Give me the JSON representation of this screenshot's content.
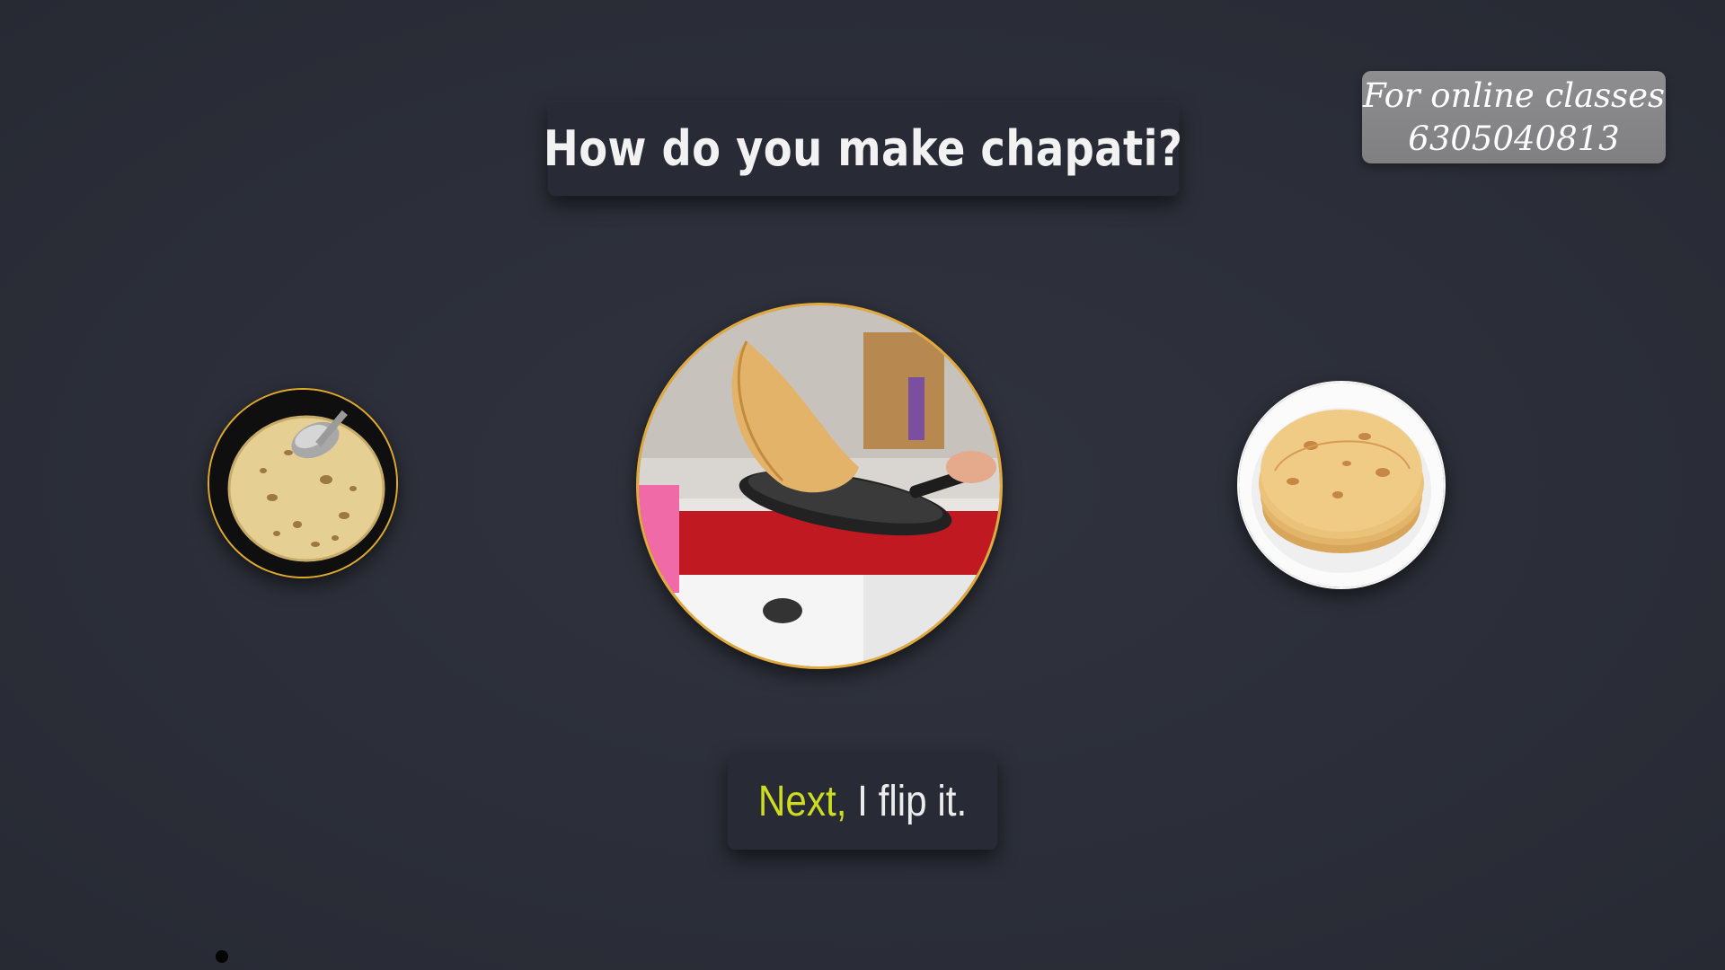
{
  "title": "How do you make chapati?",
  "promo": {
    "line1": "For online classes",
    "line2": "6305040813"
  },
  "caption": {
    "highlight": "Next,",
    "rest": " I flip it."
  },
  "images": [
    {
      "name": "chapati-on-pan",
      "icon": "chapati-with-spoon"
    },
    {
      "name": "flipping-chapati",
      "icon": "pan-flip"
    },
    {
      "name": "chapati-stack-on-plate",
      "icon": "plate-stack"
    }
  ],
  "colors": {
    "background": "#2c2f3a",
    "caption_highlight": "#cddc1f",
    "ring_gold": "#e2a93b"
  }
}
